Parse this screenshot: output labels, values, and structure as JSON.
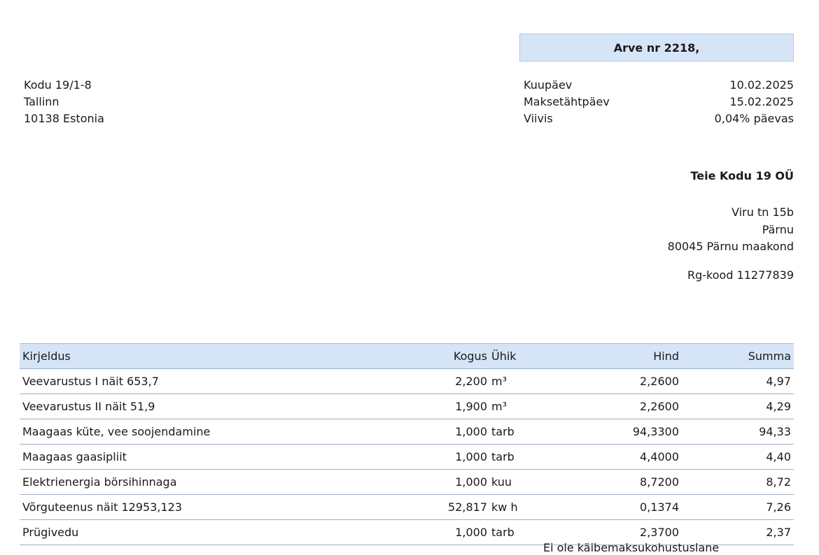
{
  "invoice": {
    "title": "Arve nr 2218,"
  },
  "customer": {
    "line1": "Kodu 19/1-8",
    "line2": "Tallinn",
    "line3": "10138 Estonia"
  },
  "meta": [
    {
      "label": "Kuupäev",
      "value": "10.02.2025"
    },
    {
      "label": "Maksetähtpäev",
      "value": "15.02.2025"
    },
    {
      "label": "Viivis",
      "value": "0,04% päevas"
    }
  ],
  "company": {
    "name": "Teie Kodu 19 OÜ",
    "street": "Viru tn 15b",
    "city": "Pärnu",
    "postal": "80045 Pärnu maakond",
    "reg": "Rg-kood 11277839"
  },
  "table": {
    "headers": {
      "description": "Kirjeldus",
      "quantity": "Kogus",
      "unit": "Ühik",
      "price": "Hind",
      "sum": "Summa"
    },
    "rows": [
      {
        "description": "Veevarustus I näit 653,7",
        "quantity": "2,200",
        "unit": "m³",
        "price": "2,2600",
        "sum": "4,97"
      },
      {
        "description": "Veevarustus II  näit 51,9",
        "quantity": "1,900",
        "unit": "m³",
        "price": "2,2600",
        "sum": "4,29"
      },
      {
        "description": "Maagaas  küte, vee soojendamine",
        "quantity": "1,000",
        "unit": "tarb",
        "price": "94,3300",
        "sum": "94,33"
      },
      {
        "description": "Maagaas gaasipliit",
        "quantity": "1,000",
        "unit": "tarb",
        "price": "4,4000",
        "sum": "4,40"
      },
      {
        "description": "Elektrienergia börsihinnaga",
        "quantity": "1,000",
        "unit": "kuu",
        "price": "8,7200",
        "sum": "8,72"
      },
      {
        "description": "Võrguteenus  näit  12953,123",
        "quantity": "52,817",
        "unit": "kw h",
        "price": "0,1374",
        "sum": "7,26"
      },
      {
        "description": "Prügivedu",
        "quantity": "1,000",
        "unit": "tarb",
        "price": "2,3700",
        "sum": "2,37"
      }
    ]
  },
  "footer": {
    "note": "Ei ole käibemaksukohustuslane"
  }
}
